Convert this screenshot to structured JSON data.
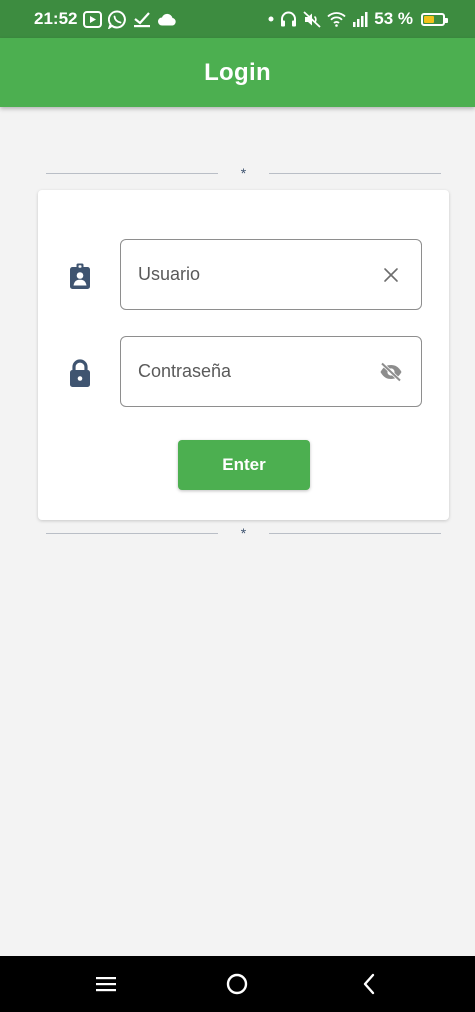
{
  "status_bar": {
    "time": "21:52",
    "battery_text": "53 %",
    "battery_level_percent": 53,
    "left_icons": [
      "media-icon",
      "whatsapp-icon",
      "download-check-icon",
      "cloud-icon"
    ],
    "right_icons": [
      "dot-icon",
      "headphones-icon",
      "mute-icon",
      "wifi-icon",
      "signal-icon",
      "battery-icon"
    ]
  },
  "app_bar": {
    "title": "Login"
  },
  "divider": {
    "symbol": "*"
  },
  "form": {
    "username": {
      "placeholder": "Usuario",
      "value": "",
      "icon": "badge-icon",
      "suffix_icon": "clear-icon"
    },
    "password": {
      "placeholder": "Contraseña",
      "value": "",
      "icon": "lock-icon",
      "suffix_icon": "visibility-off-icon"
    },
    "submit_label": "Enter"
  },
  "nav_bar": {
    "buttons": [
      "menu-icon",
      "home-icon",
      "back-icon"
    ]
  },
  "colors": {
    "status_bar": "#3d8c40",
    "primary": "#4caf50",
    "icon": "#3f5470",
    "background": "#f3f3f3",
    "card": "#ffffff",
    "battery": "#f2c21b"
  }
}
